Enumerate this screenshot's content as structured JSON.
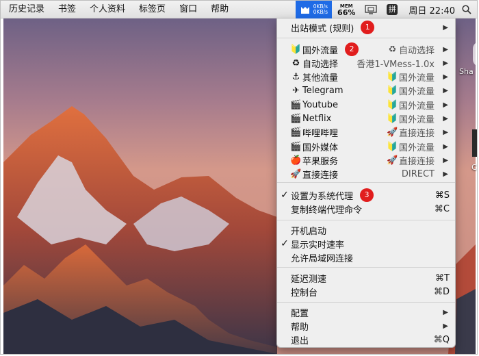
{
  "menubar": {
    "items": [
      "历史记录",
      "书签",
      "个人资料",
      "标签页",
      "窗口",
      "帮助"
    ],
    "speed_up": "0KB/s",
    "speed_down": "0KB/s",
    "mem_label": "MEM",
    "mem_value": "66%",
    "ime_label": "拼",
    "clock": "周日 22:40"
  },
  "menu": {
    "outbound_mode": {
      "label": "出站模式 (规则)",
      "badge": "1"
    },
    "proxy_groups": [
      {
        "icon": "🔰",
        "icon_name": "beginner-icon",
        "label": "国外流量",
        "badge": "2",
        "value_icon": "♻",
        "value_icon_name": "recycle-icon",
        "value": "自动选择"
      },
      {
        "icon": "♻",
        "icon_name": "recycle-icon",
        "label": "自动选择",
        "value_icon": "",
        "value_icon_name": "",
        "value": "香港1-VMess-1.0x"
      },
      {
        "icon": "⚓",
        "icon_name": "anchor-icon",
        "label": "其他流量",
        "value_icon": "🔰",
        "value_icon_name": "beginner-icon",
        "value": "国外流量"
      },
      {
        "icon": "✈",
        "icon_name": "airplane-icon",
        "label": "Telegram",
        "value_icon": "🔰",
        "value_icon_name": "beginner-icon",
        "value": "国外流量"
      },
      {
        "icon": "🎬",
        "icon_name": "clapper-icon",
        "label": "Youtube",
        "value_icon": "🔰",
        "value_icon_name": "beginner-icon",
        "value": "国外流量"
      },
      {
        "icon": "🎬",
        "icon_name": "clapper-icon",
        "label": "Netflix",
        "value_icon": "🔰",
        "value_icon_name": "beginner-icon",
        "value": "国外流量"
      },
      {
        "icon": "🎬",
        "icon_name": "clapper-icon",
        "label": "哔哩哔哩",
        "value_icon": "🚀",
        "value_icon_name": "rocket-icon",
        "value": "直接连接"
      },
      {
        "icon": "🎬",
        "icon_name": "clapper-icon",
        "label": "国外媒体",
        "value_icon": "🔰",
        "value_icon_name": "beginner-icon",
        "value": "国外流量"
      },
      {
        "icon": "🍎",
        "icon_name": "apple-icon",
        "label": "苹果服务",
        "value_icon": "🚀",
        "value_icon_name": "rocket-icon",
        "value": "直接连接"
      },
      {
        "icon": "🚀",
        "icon_name": "rocket-icon",
        "label": "直接连接",
        "value_icon": "",
        "value_icon_name": "",
        "value": "DIRECT"
      }
    ],
    "set_system_proxy": {
      "label": "设置为系统代理",
      "checked": true,
      "badge": "3",
      "shortcut": "⌘S"
    },
    "copy_terminal": {
      "label": "复制终端代理命令",
      "shortcut": "⌘C"
    },
    "launch_at_login": {
      "label": "开机启动",
      "checked": false
    },
    "show_speed": {
      "label": "显示实时速率",
      "checked": true
    },
    "allow_lan": {
      "label": "允许局域网连接",
      "checked": false
    },
    "latency_test": {
      "label": "延迟测速",
      "shortcut": "⌘T"
    },
    "dashboard": {
      "label": "控制台",
      "shortcut": "⌘D"
    },
    "config": {
      "label": "配置"
    },
    "help": {
      "label": "帮助"
    },
    "quit": {
      "label": "退出",
      "shortcut": "⌘Q"
    },
    "check_mark": "✓",
    "submenu_arrow": "▶"
  },
  "desktop": {
    "labels": [
      "Sha",
      "C"
    ]
  },
  "colors": {
    "menubar_active": "#1f6be6",
    "badge": "#e11d1d",
    "menu_bg": "#efefef"
  }
}
